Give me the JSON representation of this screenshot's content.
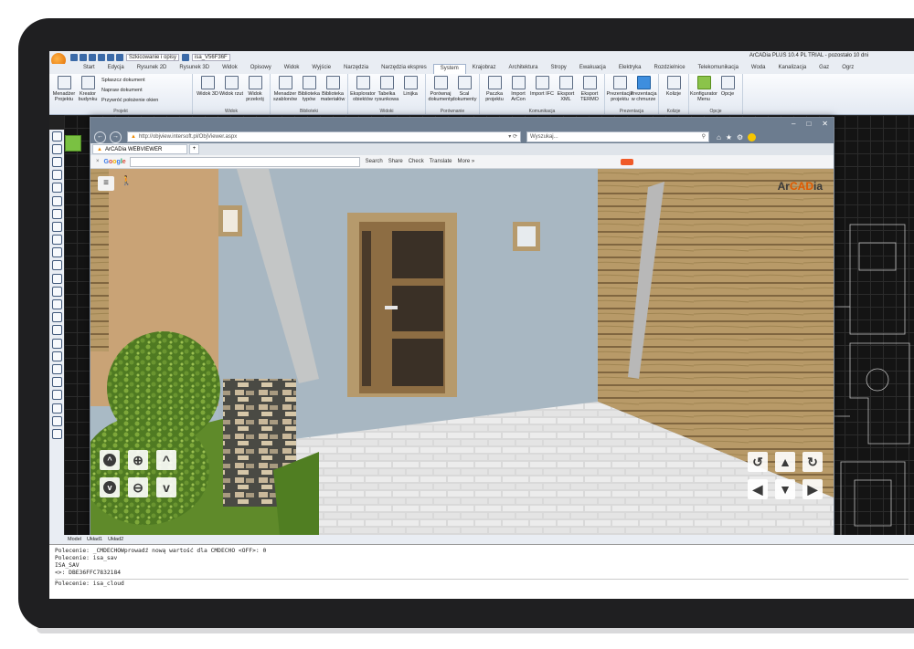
{
  "app": {
    "title": "ArCADia PLUS 10.4 PL TRIAL - pozostało 10 dni",
    "quick_access": {
      "dropdown_value": "Szkicowanie i opisy",
      "file_label": "isa_V56F36F"
    }
  },
  "ribbon_tabs": [
    "Start",
    "Edycja",
    "Rysunek 2D",
    "Rysunek 3D",
    "Widok",
    "Opisowy",
    "Widok",
    "Wyjście",
    "Narzędzia",
    "Narzędzia ekspres",
    "System",
    "Krajobraz",
    "Architektura",
    "Stropy",
    "Ewakuacja",
    "Elektryka",
    "Rozdzielnice",
    "Telekomunikacja",
    "Woda",
    "Kanalizacja",
    "Gaz",
    "Ogrz"
  ],
  "active_tab": "System",
  "ribbon": {
    "projekt": {
      "name": "Projekt",
      "buttons": [
        "Menadżer Projektu",
        "Kreator budynku"
      ],
      "small": [
        "Spłaszcz dokument",
        "Napraw dokument",
        "Przywróć położenie okien"
      ]
    },
    "widok": {
      "name": "Widok",
      "buttons": [
        "Widok 3D",
        "Widok rzut",
        "Widok przekrój"
      ]
    },
    "biblioteki": {
      "name": "Biblioteki",
      "buttons": [
        "Menadżer szablonów",
        "Biblioteka typów",
        "Biblioteka materiałów"
      ]
    },
    "widoki": {
      "name": "Widoki",
      "buttons": [
        "Eksplorator obiektów",
        "Tabelka rysunkowa",
        "Linijka"
      ]
    },
    "porownanie": {
      "name": "Porównanie",
      "buttons": [
        "Porównaj dokumenty",
        "Scal dokumenty"
      ]
    },
    "komunikacja": {
      "name": "Komunikacja",
      "buttons": [
        "Paczka projektu",
        "Import ArCon",
        "Import IFC",
        "Eksport XML",
        "Eksport TERMO"
      ]
    },
    "prezentacja": {
      "name": "Prezentacja",
      "buttons": [
        "Prezentacja projektu",
        "Prezentacja w chmurze"
      ]
    },
    "kolizje": {
      "name": "Kolizje",
      "buttons": [
        "Kolizje"
      ]
    },
    "opcje": {
      "name": "Opcje",
      "buttons": [
        "Konfigurator Menu",
        "Opcje"
      ]
    }
  },
  "browser": {
    "window_controls": [
      "–",
      "□",
      "✕"
    ],
    "url": "http://objview.intersoft.pl/ObjViewer.aspx",
    "url_controls": "▾ ⟳",
    "search_placeholder": "Wyszukaj...",
    "tab_label": "ArCADia WEBVIEWER",
    "google_toolbar": {
      "close": "×",
      "logo": [
        "G",
        "o",
        "o",
        "g",
        "l",
        "e"
      ],
      "search_btn": "Search",
      "share_btn": "Share",
      "check_btn": "Check",
      "translate_btn": "Translate",
      "more_btn": "More »"
    }
  },
  "viewer": {
    "brand": {
      "prefix": "Ar",
      "accent": "CAD",
      "suffix": "ia"
    },
    "menu_icon": "≡",
    "walk_icon": "🚶",
    "left_controls": [
      {
        "name": "rotate-up-button",
        "icon": "chevron-up-circle",
        "glyph": "^"
      },
      {
        "name": "zoom-in-button",
        "icon": "zoom-in",
        "glyph": "⊕"
      },
      {
        "name": "move-up-button",
        "icon": "chevron-up",
        "glyph": "^"
      },
      {
        "name": "rotate-down-button",
        "icon": "chevron-down-circle",
        "glyph": "v"
      },
      {
        "name": "zoom-out-button",
        "icon": "zoom-out",
        "glyph": "⊖"
      },
      {
        "name": "move-down-button",
        "icon": "chevron-down",
        "glyph": "v"
      }
    ],
    "right_controls": [
      {
        "name": "rotate-left-button",
        "icon": "rotate-ccw",
        "glyph": "↺"
      },
      {
        "name": "move-forward-button",
        "icon": "arrow-up",
        "glyph": "▲"
      },
      {
        "name": "rotate-right-button",
        "icon": "rotate-cw",
        "glyph": "↻"
      },
      {
        "name": "move-left-button",
        "icon": "arrow-left",
        "glyph": "◀"
      },
      {
        "name": "move-back-button",
        "icon": "arrow-down",
        "glyph": "▼"
      },
      {
        "name": "move-right-button",
        "icon": "arrow-right",
        "glyph": "▶"
      }
    ]
  },
  "model_tabs": [
    "Model",
    "Układ1",
    "Układ2"
  ],
  "command_lines": [
    "Polecenie: _CMDECHOWprowadź nową wartość dla CMDECHO <OFF>: 0",
    "Polecenie: isa_sav",
    "ISA_SAV",
    "<>: DBE36FFC7832184"
  ],
  "command_input": "Polecenie: isa_cloud",
  "colors": {
    "accent": "#f08a00",
    "ribbon_bg": "#e3e9f2",
    "cad_bg": "#141414"
  }
}
